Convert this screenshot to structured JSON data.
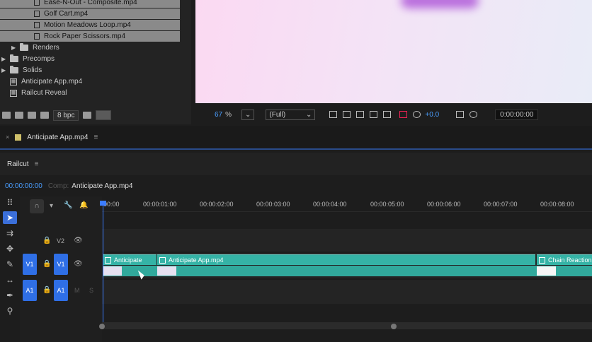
{
  "project": {
    "files": [
      {
        "label": "Ease-N-Out - Composite.mp4"
      },
      {
        "label": "Golf Cart.mp4"
      },
      {
        "label": "Motion Meadows Loop.mp4"
      },
      {
        "label": "Rock Paper Scissors.mp4"
      }
    ],
    "folders": [
      {
        "label": "Renders"
      },
      {
        "label": "Precomps"
      },
      {
        "label": "Solids"
      }
    ],
    "items": [
      {
        "label": "Anticipate App.mp4"
      },
      {
        "label": "Railcut Reveal"
      }
    ],
    "bit_depth": "8 bpc"
  },
  "viewer": {
    "zoom": "67",
    "zoom_unit": "%",
    "resolution": "(Full)",
    "exposure": "+0.0",
    "timecode": "0:00:00:00"
  },
  "comp_tab": {
    "title": "Anticipate App.mp4"
  },
  "timeline": {
    "panel_title": "Railcut",
    "timecode": "00:00:00:00",
    "comp_prefix": "Comp:",
    "comp_name": "Anticipate App.mp4",
    "ruler_ticks": [
      "00:00",
      "00:00:01:00",
      "00:00:02:00",
      "00:00:03:00",
      "00:00:04:00",
      "00:00:05:00",
      "00:00:06:00",
      "00:00:07:00",
      "00:00:08:00"
    ],
    "tracks": {
      "v2": "V2",
      "v1": "V1",
      "a1": "A1",
      "mute": "M",
      "solo": "S"
    },
    "clips": [
      {
        "label": "Anticipate"
      },
      {
        "label": "Anticipate App.mp4"
      },
      {
        "label": "Chain Reaction"
      }
    ]
  },
  "colors": {
    "accent": "#3b6fd9",
    "clip": "#35b3a6",
    "timecode": "#4a9eff"
  }
}
